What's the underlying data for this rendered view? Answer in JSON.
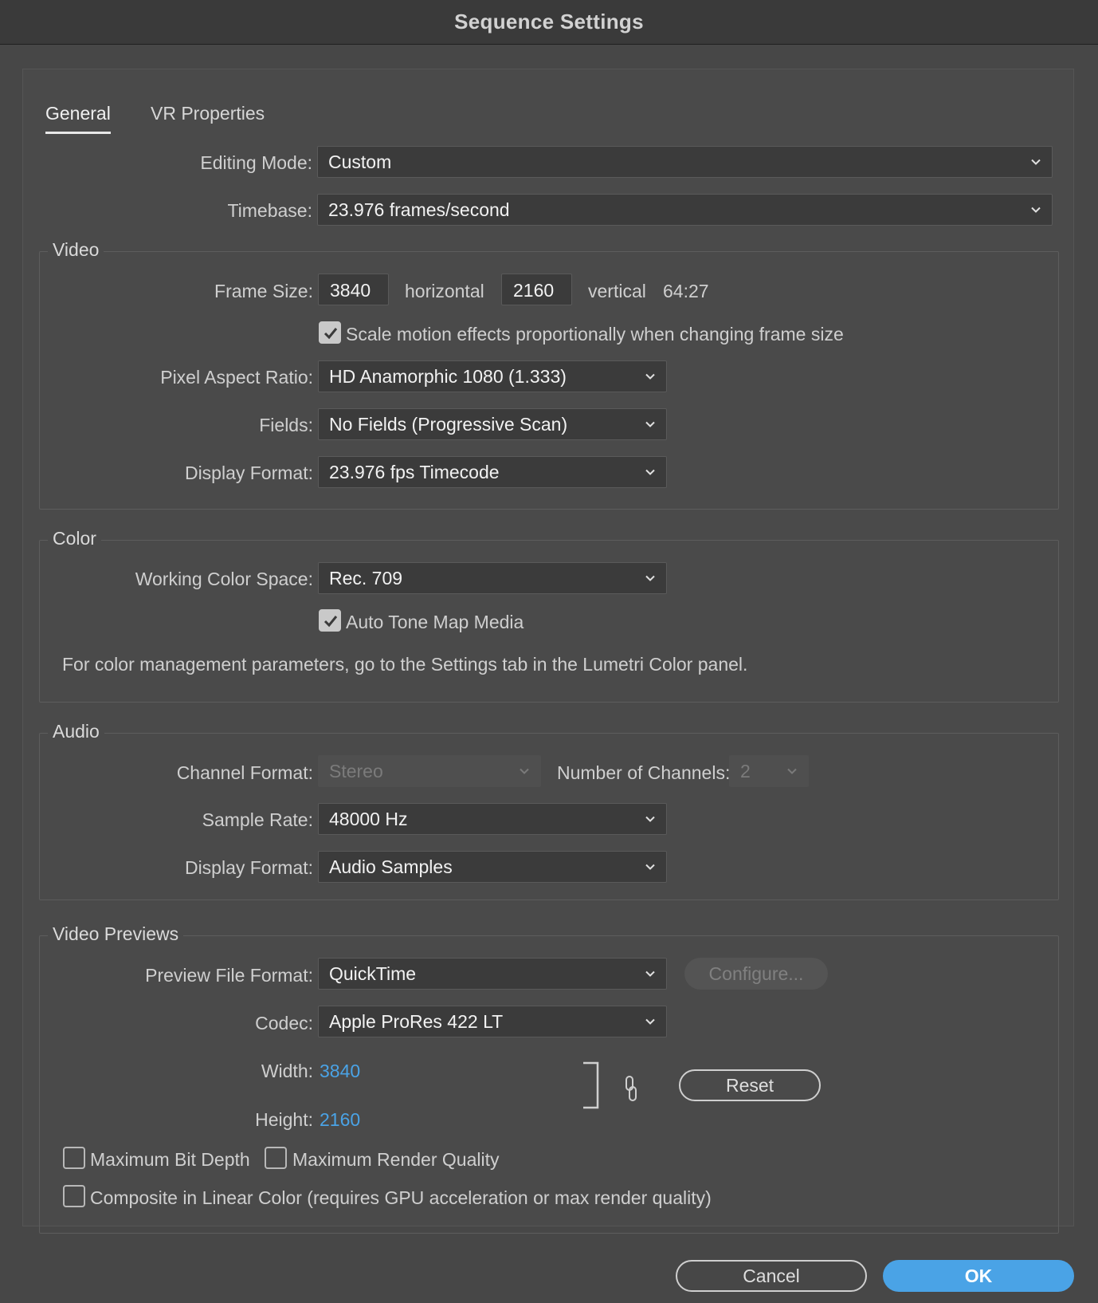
{
  "window": {
    "title": "Sequence Settings"
  },
  "tabs": [
    {
      "label": "General",
      "active": true
    },
    {
      "label": "VR Properties",
      "active": false
    }
  ],
  "general": {
    "editing_mode_label": "Editing Mode:",
    "editing_mode_value": "Custom",
    "timebase_label": "Timebase:",
    "timebase_value": "23.976  frames/second"
  },
  "video": {
    "title": "Video",
    "frame_size_label": "Frame Size:",
    "frame_width": "3840",
    "horizontal_label": "horizontal",
    "frame_height": "2160",
    "vertical_label": "vertical",
    "aspect": "64:27",
    "scale_motion_label": "Scale motion effects proportionally when changing frame size",
    "scale_motion_checked": true,
    "pixel_aspect_label": "Pixel Aspect Ratio:",
    "pixel_aspect_value": "HD Anamorphic 1080 (1.333)",
    "fields_label": "Fields:",
    "fields_value": "No Fields (Progressive Scan)",
    "display_format_label": "Display Format:",
    "display_format_value": "23.976 fps Timecode"
  },
  "color": {
    "title": "Color",
    "working_space_label": "Working Color Space:",
    "working_space_value": "Rec. 709",
    "auto_tone_label": "Auto Tone Map Media",
    "auto_tone_checked": true,
    "note": "For color management parameters, go to the Settings tab in the Lumetri Color panel."
  },
  "audio": {
    "title": "Audio",
    "channel_format_label": "Channel Format:",
    "channel_format_value": "Stereo",
    "num_channels_label": "Number of Channels:",
    "num_channels_value": "2",
    "sample_rate_label": "Sample Rate:",
    "sample_rate_value": "48000 Hz",
    "display_format_label": "Display Format:",
    "display_format_value": "Audio Samples"
  },
  "previews": {
    "title": "Video Previews",
    "file_format_label": "Preview File Format:",
    "file_format_value": "QuickTime",
    "configure_label": "Configure...",
    "codec_label": "Codec:",
    "codec_value": "Apple ProRes 422 LT",
    "width_label": "Width:",
    "width_value": "3840",
    "height_label": "Height:",
    "height_value": "2160",
    "reset_label": "Reset",
    "max_bit_depth_label": "Maximum Bit Depth",
    "max_render_quality_label": "Maximum Render Quality",
    "composite_linear_label": "Composite in Linear Color (requires GPU acceleration or max render quality)"
  },
  "footer": {
    "cancel_label": "Cancel",
    "ok_label": "OK"
  },
  "colors": {
    "accent": "#4aa3e6",
    "background": "#474747"
  }
}
